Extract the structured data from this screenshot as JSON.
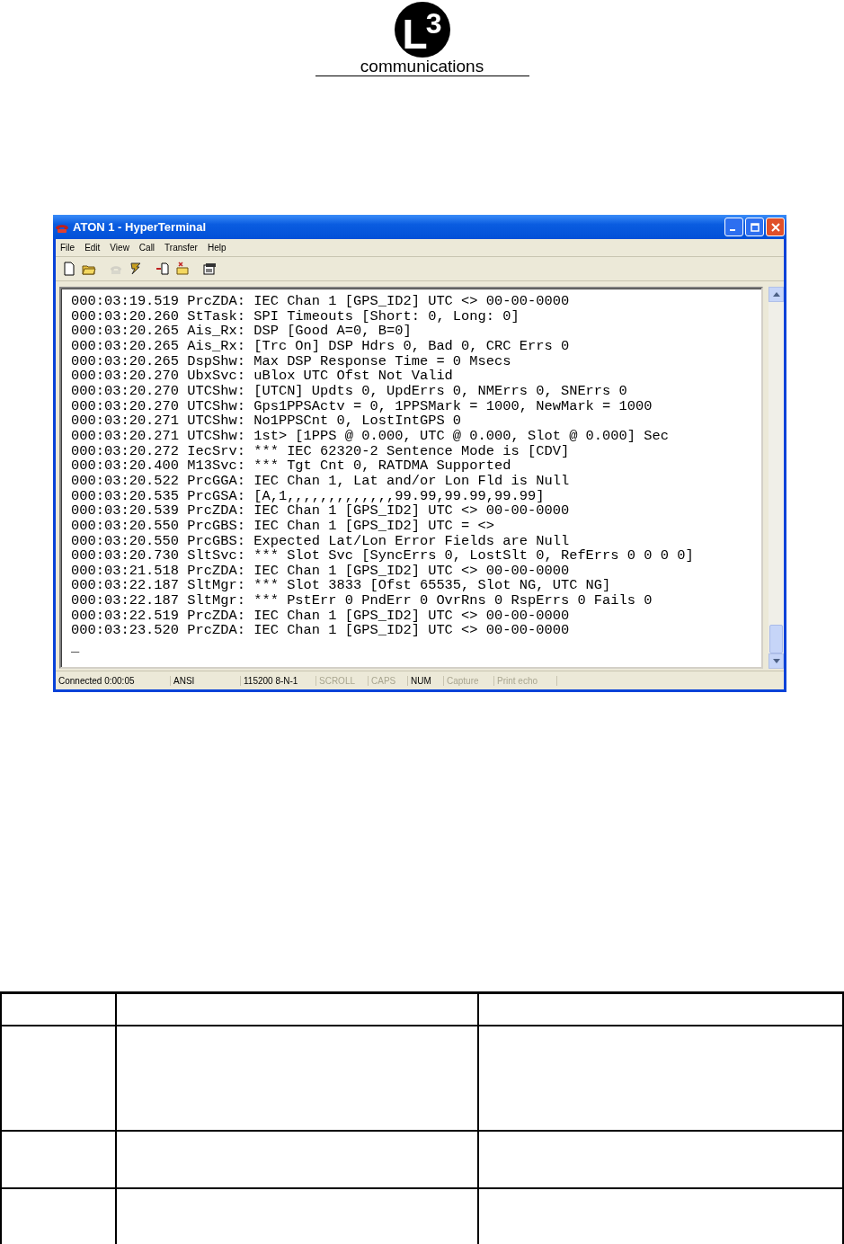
{
  "logo": {
    "mark": "L3",
    "name": "communications"
  },
  "window": {
    "title": "ATON 1 - HyperTerminal"
  },
  "menu": [
    "File",
    "Edit",
    "View",
    "Call",
    "Transfer",
    "Help"
  ],
  "toolbar": [
    {
      "kind": "new",
      "disabled": false
    },
    {
      "kind": "open",
      "disabled": false
    },
    {
      "kind": "sep"
    },
    {
      "kind": "phone",
      "disabled": true
    },
    {
      "kind": "hangup",
      "disabled": false
    },
    {
      "kind": "sep"
    },
    {
      "kind": "send",
      "disabled": false
    },
    {
      "kind": "receive",
      "disabled": false
    },
    {
      "kind": "sep"
    },
    {
      "kind": "properties",
      "disabled": false
    }
  ],
  "terminal": {
    "lines": [
      "000:03:19.519 PrcZDA: IEC Chan 1 [GPS_ID2] UTC <> 00-00-0000",
      "000:03:20.260 StTask: SPI Timeouts [Short: 0, Long: 0]",
      "000:03:20.265 Ais_Rx: DSP [Good A=0, B=0]",
      "000:03:20.265 Ais_Rx: [Trc On] DSP Hdrs 0, Bad 0, CRC Errs 0",
      "000:03:20.265 DspShw: Max DSP Response Time = 0 Msecs",
      "000:03:20.270 UbxSvc: uBlox UTC Ofst Not Valid",
      "000:03:20.270 UTCShw: [UTCN] Updts 0, UpdErrs 0, NMErrs 0, SNErrs 0",
      "000:03:20.270 UTCShw: Gps1PPSActv = 0, 1PPSMark = 1000, NewMark = 1000",
      "000:03:20.271 UTCShw: No1PPSCnt 0, LostIntGPS 0",
      "000:03:20.271 UTCShw: 1st> [1PPS @ 0.000, UTC @ 0.000, Slot @ 0.000] Sec",
      "000:03:20.272 IecSrv: *** IEC 62320-2 Sentence Mode is [CDV]",
      "000:03:20.400 M13Svc: *** Tgt Cnt 0, RATDMA Supported",
      "000:03:20.522 PrcGGA: IEC Chan 1, Lat and/or Lon Fld is Null",
      "000:03:20.535 PrcGSA: [A,1,,,,,,,,,,,,,99.99,99.99,99.99]",
      "000:03:20.539 PrcZDA: IEC Chan 1 [GPS_ID2] UTC <> 00-00-0000",
      "000:03:20.550 PrcGBS: IEC Chan 1 [GPS_ID2] UTC = <>",
      "000:03:20.550 PrcGBS: Expected Lat/Lon Error Fields are Null",
      "000:03:20.730 SltSvc: *** Slot Svc [SyncErrs 0, LostSlt 0, RefErrs 0 0 0 0]",
      "000:03:21.518 PrcZDA: IEC Chan 1 [GPS_ID2] UTC <> 00-00-0000",
      "000:03:22.187 SltMgr: *** Slot 3833 [Ofst 65535, Slot NG, UTC NG]",
      "000:03:22.187 SltMgr: *** PstErr 0 PndErr 0 OvrRns 0 RspErrs 0 Fails 0",
      "000:03:22.519 PrcZDA: IEC Chan 1 [GPS_ID2] UTC <> 00-00-0000",
      "000:03:23.520 PrcZDA: IEC Chan 1 [GPS_ID2] UTC <> 00-00-0000"
    ],
    "cursor": "_"
  },
  "status_bar": [
    {
      "label": "Connected 0:00:05",
      "active": true
    },
    {
      "label": "ANSI",
      "active": true
    },
    {
      "label": "115200 8-N-1",
      "active": true
    },
    {
      "label": "SCROLL",
      "active": false
    },
    {
      "label": "CAPS",
      "active": false
    },
    {
      "label": "NUM",
      "active": true
    },
    {
      "label": "Capture",
      "active": false
    },
    {
      "label": "Print echo",
      "active": false
    }
  ]
}
